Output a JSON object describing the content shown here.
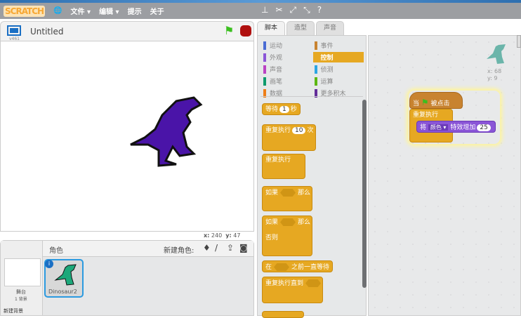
{
  "menubar": {
    "logo": "SCRATCH",
    "items": [
      "文件 ▾",
      "编辑 ▾",
      "提示",
      "关于"
    ],
    "tools": [
      "stamp-icon",
      "cut-icon",
      "grow-icon",
      "shrink-icon",
      "help-icon"
    ]
  },
  "stage": {
    "title": "Untitled",
    "version": "v461",
    "x_label": "x:",
    "x": "240",
    "y_label": "y:",
    "y": "47"
  },
  "sprites": {
    "header": "角色",
    "new_sprite": "新建角色:",
    "stage_label": "舞台",
    "backdrops": "1 背景",
    "new_backdrop": "新建背景",
    "sprite_name": "Dinosaur2"
  },
  "tabs": [
    "脚本",
    "造型",
    "声音"
  ],
  "categories": [
    {
      "label": "运动",
      "color": "#4a6cd4"
    },
    {
      "label": "事件",
      "color": "#c88330"
    },
    {
      "label": "外观",
      "color": "#8a55d7"
    },
    {
      "label": "控制",
      "color": "#e6a822"
    },
    {
      "label": "声音",
      "color": "#bb42c3"
    },
    {
      "label": "侦测",
      "color": "#2ca5e2"
    },
    {
      "label": "画笔",
      "color": "#0e9a6c"
    },
    {
      "label": "运算",
      "color": "#5cb712"
    },
    {
      "label": "数据",
      "color": "#ee7d16"
    },
    {
      "label": "更多积木",
      "color": "#632d99"
    }
  ],
  "blocks": {
    "wait": "等待",
    "wait_val": "1",
    "sec": "秒",
    "repeat": "重复执行",
    "repeat_val": "10",
    "times": "次",
    "forever": "重复执行",
    "if": "如果",
    "then": "那么",
    "else": "否则",
    "wait_until_a": "在",
    "wait_until_b": "之前一直等待",
    "repeat_until": "重复执行直到"
  },
  "script": {
    "hat_a": "当",
    "hat_b": "被点击",
    "forever": "重复执行",
    "effect_a": "将",
    "effect_sel": "颜色",
    "effect_b": "特效增加",
    "effect_val": "25",
    "sprite_x": "x: 68",
    "sprite_y": "y: 9"
  }
}
